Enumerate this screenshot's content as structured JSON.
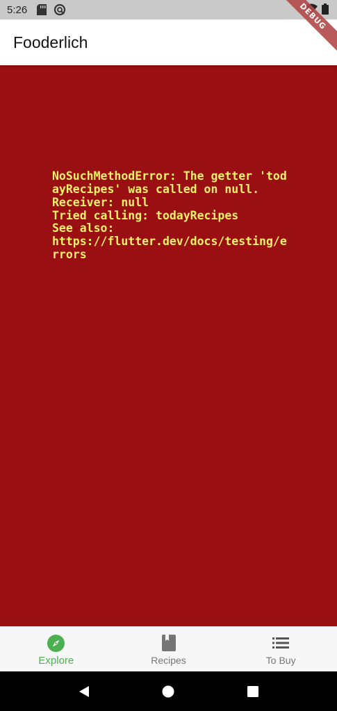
{
  "status_bar": {
    "time": "5:26",
    "icons": [
      "sd-card-icon",
      "no-disturb-icon",
      "wifi-icon",
      "battery-icon"
    ]
  },
  "debug_banner": {
    "label": "DEBUG"
  },
  "app_bar": {
    "title": "Fooderlich"
  },
  "error": {
    "background": "#9a0f12",
    "text_color": "#f6ef6b",
    "lines": [
      "NoSuchMethodError: The getter 'todayRecipes' was called on null.",
      "Receiver: null",
      "Tried calling: todayRecipes",
      "See also:",
      "https://flutter.dev/docs/testing/errors"
    ]
  },
  "bottom_nav": {
    "active_color": "#4caf50",
    "items": [
      {
        "label": "Explore",
        "icon": "compass-icon",
        "active": true
      },
      {
        "label": "Recipes",
        "icon": "book-icon",
        "active": false
      },
      {
        "label": "To Buy",
        "icon": "list-icon",
        "active": false
      }
    ]
  },
  "system_nav": {
    "buttons": [
      "back-icon",
      "home-icon",
      "recents-icon"
    ]
  }
}
